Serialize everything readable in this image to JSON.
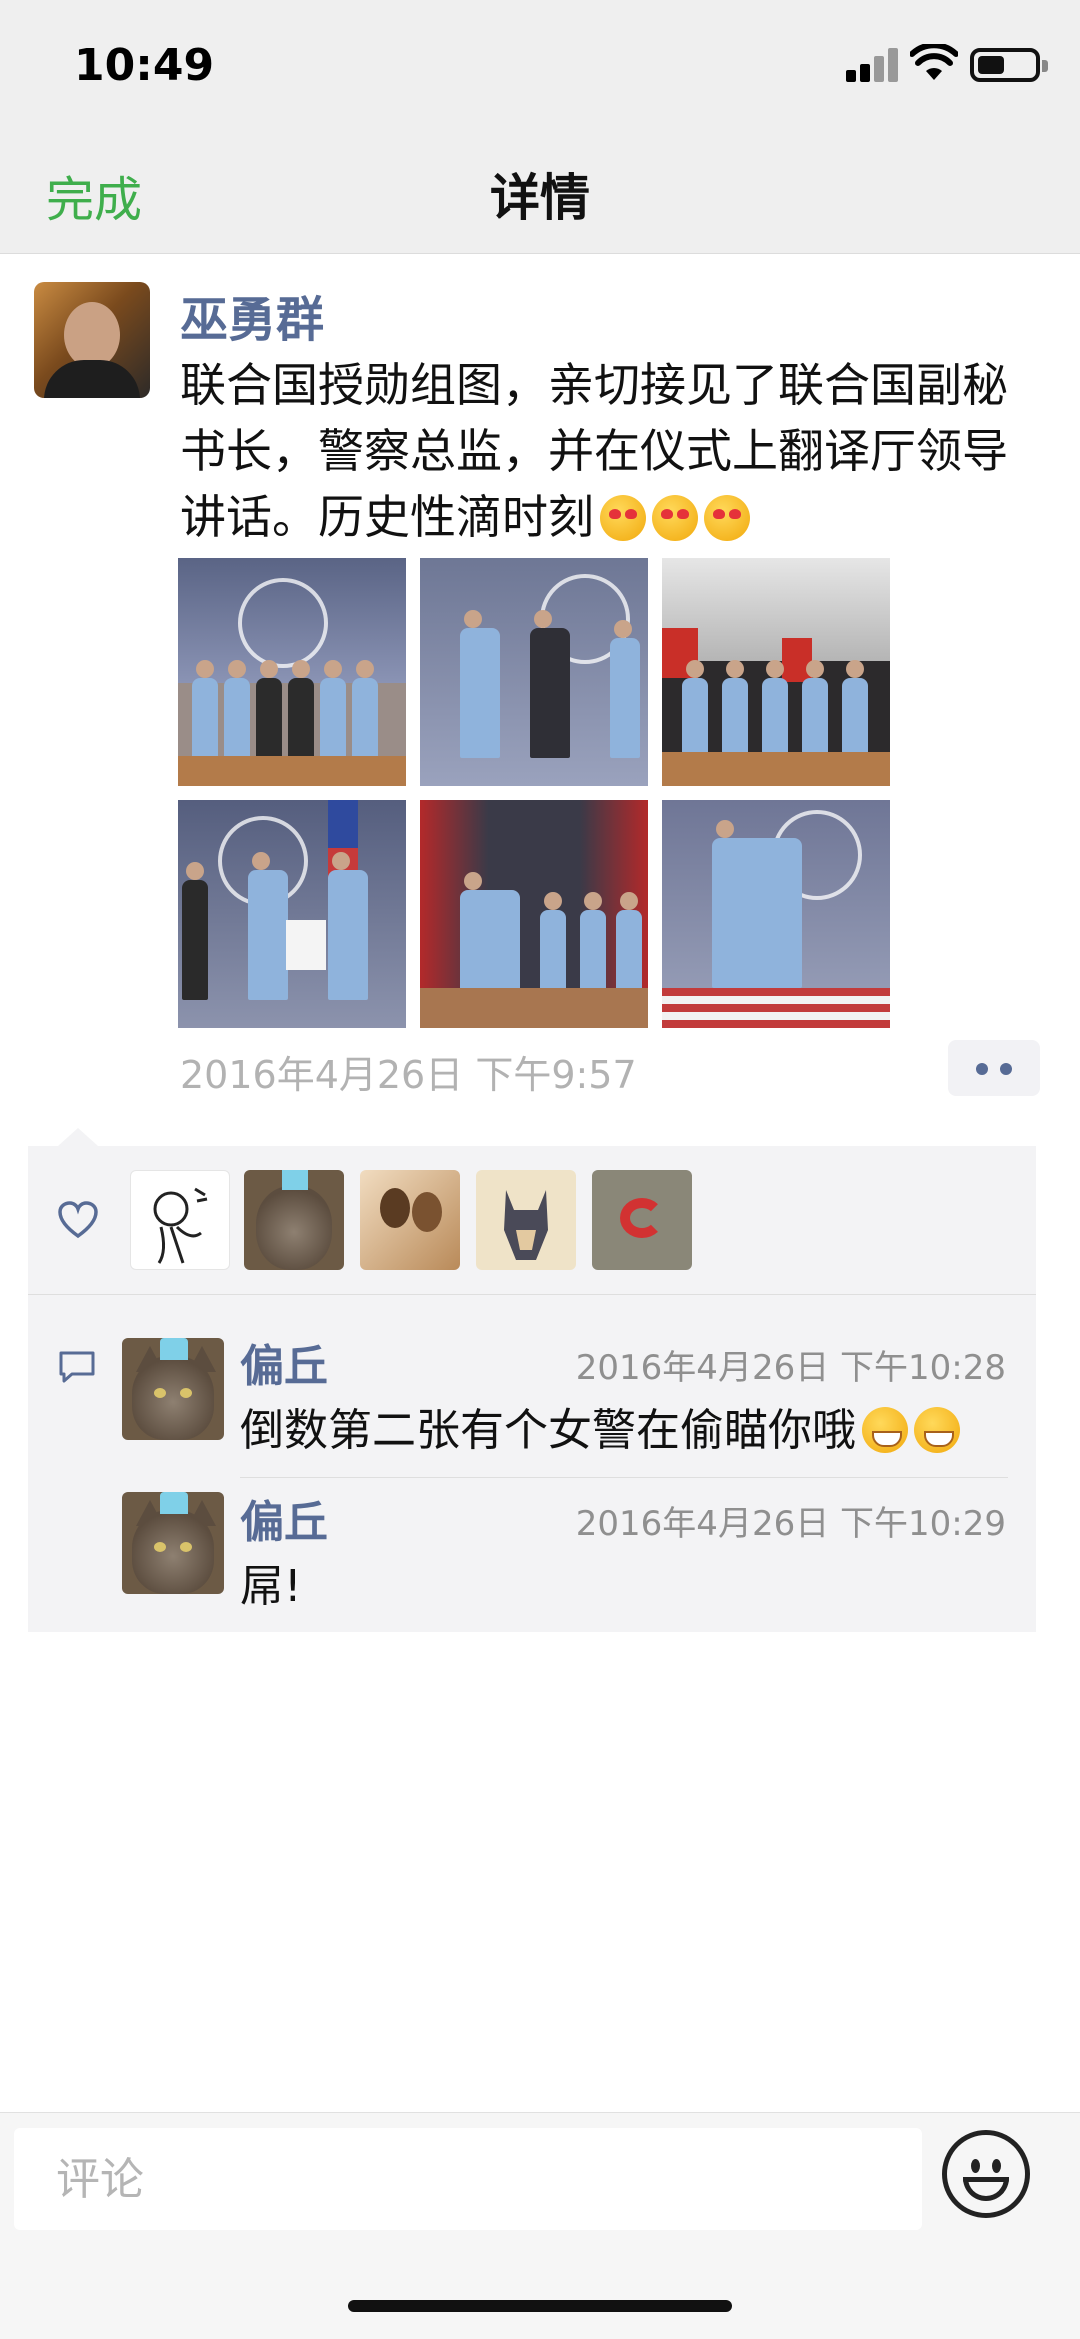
{
  "status_bar": {
    "time": "10:49"
  },
  "nav": {
    "done_label": "完成",
    "title": "详情"
  },
  "post": {
    "author": "巫勇群",
    "text": "联合国授勋组图，亲切接见了联合国副秘书长，警察总监，并在仪式上翻译厅领导讲话。历史性滴时刻",
    "text_emojis": [
      "heart-eyes",
      "heart-eyes",
      "heart-eyes"
    ],
    "photos": [
      {
        "scene": "group-photo-un-emblem"
      },
      {
        "scene": "handshake-un-mission-liberia"
      },
      {
        "scene": "salute-row-flags"
      },
      {
        "scene": "certificate-presentation"
      },
      {
        "scene": "signing-at-desk"
      },
      {
        "scene": "portrait-un-emblem"
      }
    ],
    "date": "2016年4月26日 下午9:57"
  },
  "likes": {
    "icon": "heart-icon",
    "avatars": [
      "sketch-figure",
      "cat",
      "couple",
      "batman",
      "red-logo"
    ]
  },
  "comments": [
    {
      "name": "偏丘",
      "time": "2016年4月26日 下午10:28",
      "text": "倒数第二张有个女警在偷瞄你哦",
      "emojis": [
        "grin",
        "grin"
      ]
    },
    {
      "name": "偏丘",
      "time": "2016年4月26日 下午10:29",
      "text": "屌!",
      "emojis": []
    }
  ],
  "composer": {
    "placeholder": "评论",
    "emoji_icon": "smiley-icon"
  },
  "colors": {
    "accent_green": "#3fae4c",
    "name_blue": "#576b95",
    "meta_gray": "#b2b2b2"
  }
}
